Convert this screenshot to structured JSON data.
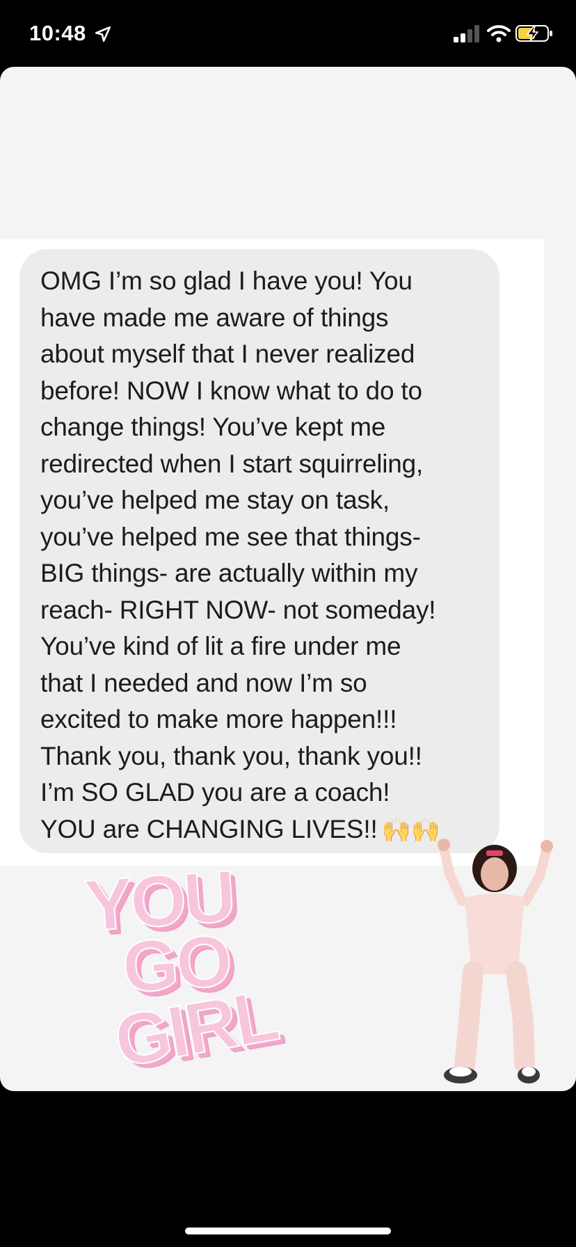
{
  "status_bar": {
    "time": "10:48",
    "location_icon": "location-arrow-icon",
    "signal_icon": "cellular-signal-icon",
    "wifi_icon": "wifi-icon",
    "battery_icon": "battery-charging-icon",
    "battery_color": "#f5d33b"
  },
  "message": {
    "lines": [
      "OMG I’m so glad I have you! You",
      "have made me aware of things",
      "about myself that I never realized",
      "before! NOW I know what to do to",
      "change things! You’ve kept me",
      "redirected when I start squirreling,",
      "you’ve helped me stay on task,",
      "you’ve helped me see that things-",
      "BIG things- are actually within my",
      "reach- RIGHT NOW- not someday!",
      "You’ve kind of lit a fire under me",
      "that I needed and now I’m so",
      "excited to make more happen!!!",
      "Thank you, thank you, thank you!!",
      "I’m SO GLAD you are a coach!",
      "YOU are CHANGING LIVES!!"
    ],
    "emoji": "🙌🙌"
  },
  "sticker": {
    "line1": "YOU",
    "line2": "GO",
    "line3": "GIRL"
  },
  "colors": {
    "bubble": "#ececec",
    "card": "#f4f4f4",
    "sticker_pink": "#f7c6dd"
  }
}
